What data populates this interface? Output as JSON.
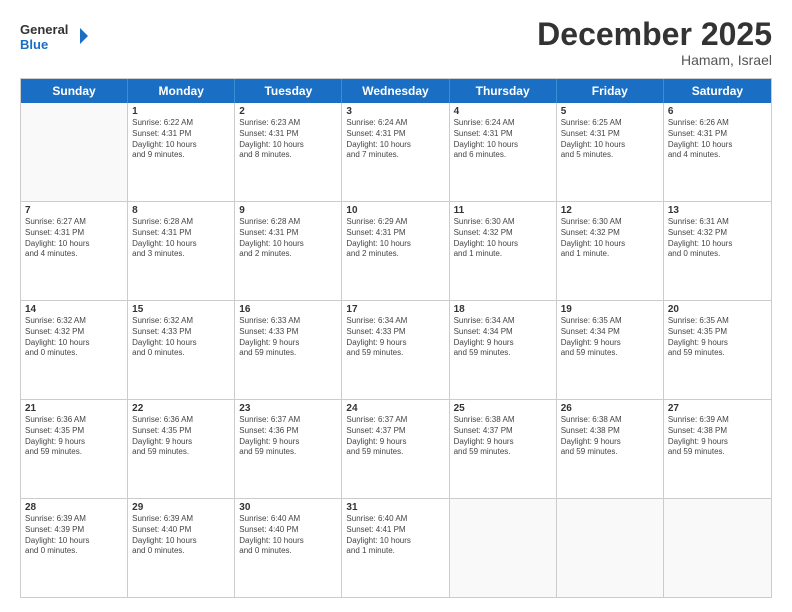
{
  "header": {
    "logo_general": "General",
    "logo_blue": "Blue",
    "month": "December 2025",
    "location": "Hamam, Israel"
  },
  "days": [
    "Sunday",
    "Monday",
    "Tuesday",
    "Wednesday",
    "Thursday",
    "Friday",
    "Saturday"
  ],
  "weeks": [
    [
      {
        "day": "",
        "info": [],
        "empty": true
      },
      {
        "day": "1",
        "info": [
          "Sunrise: 6:22 AM",
          "Sunset: 4:31 PM",
          "Daylight: 10 hours",
          "and 9 minutes."
        ]
      },
      {
        "day": "2",
        "info": [
          "Sunrise: 6:23 AM",
          "Sunset: 4:31 PM",
          "Daylight: 10 hours",
          "and 8 minutes."
        ]
      },
      {
        "day": "3",
        "info": [
          "Sunrise: 6:24 AM",
          "Sunset: 4:31 PM",
          "Daylight: 10 hours",
          "and 7 minutes."
        ]
      },
      {
        "day": "4",
        "info": [
          "Sunrise: 6:24 AM",
          "Sunset: 4:31 PM",
          "Daylight: 10 hours",
          "and 6 minutes."
        ]
      },
      {
        "day": "5",
        "info": [
          "Sunrise: 6:25 AM",
          "Sunset: 4:31 PM",
          "Daylight: 10 hours",
          "and 5 minutes."
        ]
      },
      {
        "day": "6",
        "info": [
          "Sunrise: 6:26 AM",
          "Sunset: 4:31 PM",
          "Daylight: 10 hours",
          "and 4 minutes."
        ]
      }
    ],
    [
      {
        "day": "7",
        "info": [
          "Sunrise: 6:27 AM",
          "Sunset: 4:31 PM",
          "Daylight: 10 hours",
          "and 4 minutes."
        ]
      },
      {
        "day": "8",
        "info": [
          "Sunrise: 6:28 AM",
          "Sunset: 4:31 PM",
          "Daylight: 10 hours",
          "and 3 minutes."
        ]
      },
      {
        "day": "9",
        "info": [
          "Sunrise: 6:28 AM",
          "Sunset: 4:31 PM",
          "Daylight: 10 hours",
          "and 2 minutes."
        ]
      },
      {
        "day": "10",
        "info": [
          "Sunrise: 6:29 AM",
          "Sunset: 4:31 PM",
          "Daylight: 10 hours",
          "and 2 minutes."
        ]
      },
      {
        "day": "11",
        "info": [
          "Sunrise: 6:30 AM",
          "Sunset: 4:32 PM",
          "Daylight: 10 hours",
          "and 1 minute."
        ]
      },
      {
        "day": "12",
        "info": [
          "Sunrise: 6:30 AM",
          "Sunset: 4:32 PM",
          "Daylight: 10 hours",
          "and 1 minute."
        ]
      },
      {
        "day": "13",
        "info": [
          "Sunrise: 6:31 AM",
          "Sunset: 4:32 PM",
          "Daylight: 10 hours",
          "and 0 minutes."
        ]
      }
    ],
    [
      {
        "day": "14",
        "info": [
          "Sunrise: 6:32 AM",
          "Sunset: 4:32 PM",
          "Daylight: 10 hours",
          "and 0 minutes."
        ]
      },
      {
        "day": "15",
        "info": [
          "Sunrise: 6:32 AM",
          "Sunset: 4:33 PM",
          "Daylight: 10 hours",
          "and 0 minutes."
        ]
      },
      {
        "day": "16",
        "info": [
          "Sunrise: 6:33 AM",
          "Sunset: 4:33 PM",
          "Daylight: 9 hours",
          "and 59 minutes."
        ]
      },
      {
        "day": "17",
        "info": [
          "Sunrise: 6:34 AM",
          "Sunset: 4:33 PM",
          "Daylight: 9 hours",
          "and 59 minutes."
        ]
      },
      {
        "day": "18",
        "info": [
          "Sunrise: 6:34 AM",
          "Sunset: 4:34 PM",
          "Daylight: 9 hours",
          "and 59 minutes."
        ]
      },
      {
        "day": "19",
        "info": [
          "Sunrise: 6:35 AM",
          "Sunset: 4:34 PM",
          "Daylight: 9 hours",
          "and 59 minutes."
        ]
      },
      {
        "day": "20",
        "info": [
          "Sunrise: 6:35 AM",
          "Sunset: 4:35 PM",
          "Daylight: 9 hours",
          "and 59 minutes."
        ]
      }
    ],
    [
      {
        "day": "21",
        "info": [
          "Sunrise: 6:36 AM",
          "Sunset: 4:35 PM",
          "Daylight: 9 hours",
          "and 59 minutes."
        ]
      },
      {
        "day": "22",
        "info": [
          "Sunrise: 6:36 AM",
          "Sunset: 4:35 PM",
          "Daylight: 9 hours",
          "and 59 minutes."
        ]
      },
      {
        "day": "23",
        "info": [
          "Sunrise: 6:37 AM",
          "Sunset: 4:36 PM",
          "Daylight: 9 hours",
          "and 59 minutes."
        ]
      },
      {
        "day": "24",
        "info": [
          "Sunrise: 6:37 AM",
          "Sunset: 4:37 PM",
          "Daylight: 9 hours",
          "and 59 minutes."
        ]
      },
      {
        "day": "25",
        "info": [
          "Sunrise: 6:38 AM",
          "Sunset: 4:37 PM",
          "Daylight: 9 hours",
          "and 59 minutes."
        ]
      },
      {
        "day": "26",
        "info": [
          "Sunrise: 6:38 AM",
          "Sunset: 4:38 PM",
          "Daylight: 9 hours",
          "and 59 minutes."
        ]
      },
      {
        "day": "27",
        "info": [
          "Sunrise: 6:39 AM",
          "Sunset: 4:38 PM",
          "Daylight: 9 hours",
          "and 59 minutes."
        ]
      }
    ],
    [
      {
        "day": "28",
        "info": [
          "Sunrise: 6:39 AM",
          "Sunset: 4:39 PM",
          "Daylight: 10 hours",
          "and 0 minutes."
        ]
      },
      {
        "day": "29",
        "info": [
          "Sunrise: 6:39 AM",
          "Sunset: 4:40 PM",
          "Daylight: 10 hours",
          "and 0 minutes."
        ]
      },
      {
        "day": "30",
        "info": [
          "Sunrise: 6:40 AM",
          "Sunset: 4:40 PM",
          "Daylight: 10 hours",
          "and 0 minutes."
        ]
      },
      {
        "day": "31",
        "info": [
          "Sunrise: 6:40 AM",
          "Sunset: 4:41 PM",
          "Daylight: 10 hours",
          "and 1 minute."
        ]
      },
      {
        "day": "",
        "info": [],
        "empty": true
      },
      {
        "day": "",
        "info": [],
        "empty": true
      },
      {
        "day": "",
        "info": [],
        "empty": true
      }
    ]
  ]
}
